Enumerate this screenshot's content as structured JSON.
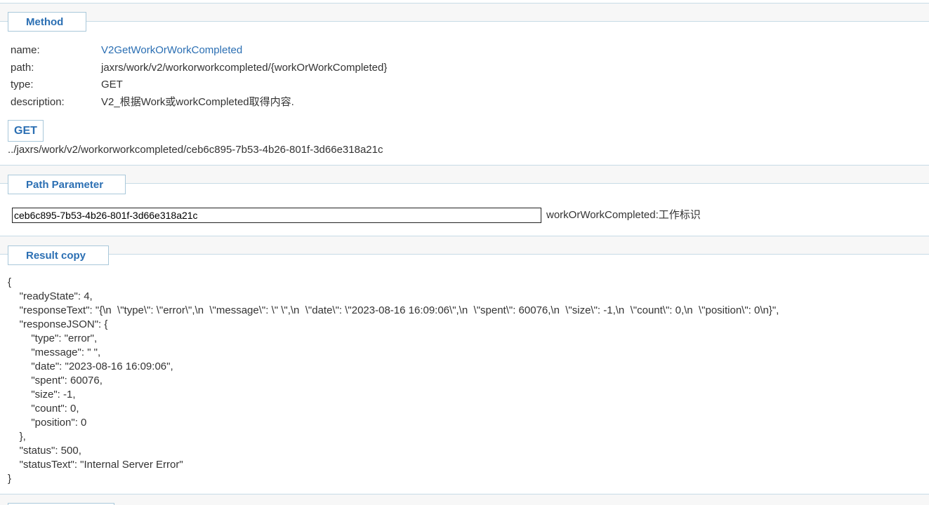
{
  "method_section": {
    "title": "Method",
    "fields": [
      {
        "label": "name:",
        "value": "V2GetWorkOrWorkCompleted"
      },
      {
        "label": "path:",
        "value": "jaxrs/work/v2/workorworkcompleted/{workOrWorkCompleted}"
      },
      {
        "label": "type:",
        "value": "GET"
      },
      {
        "label": "description:",
        "value": "V2_根据Work或workCompleted取得内容."
      }
    ],
    "get_button": "GET",
    "url": "../jaxrs/work/v2/workorworkcompleted/ceb6c895-7b53-4b26-801f-3d66e318a21c"
  },
  "path_parameter_section": {
    "title": "Path Parameter",
    "input_value": "ceb6c895-7b53-4b26-801f-3d66e318a21c",
    "param_desc": "workOrWorkCompleted:工作标识"
  },
  "result_section": {
    "title": "Result copy",
    "lines": [
      "{",
      "    \"readyState\": 4,",
      "    \"responseText\": \"{\\n  \\\"type\\\": \\\"error\\\",\\n  \\\"message\\\": \\\" \\\",\\n  \\\"date\\\": \\\"2023-08-16 16:09:06\\\",\\n  \\\"spent\\\": 60076,\\n  \\\"size\\\": -1,\\n  \\\"count\\\": 0,\\n  \\\"position\\\": 0\\n}\",",
      "    \"responseJSON\": {",
      "        \"type\": \"error\",",
      "        \"message\": \" \",",
      "        \"date\": \"2023-08-16 16:09:06\",",
      "        \"spent\": 60076,",
      "        \"size\": -1,",
      "        \"count\": 0,",
      "        \"position\": 0",
      "    },",
      "    \"status\": 500,",
      "    \"statusText\": \"Internal Server Error\"",
      "}"
    ]
  },
  "colors": {
    "accent": "#2b6fb3",
    "border": "#a9c8da",
    "text": "#333333"
  }
}
